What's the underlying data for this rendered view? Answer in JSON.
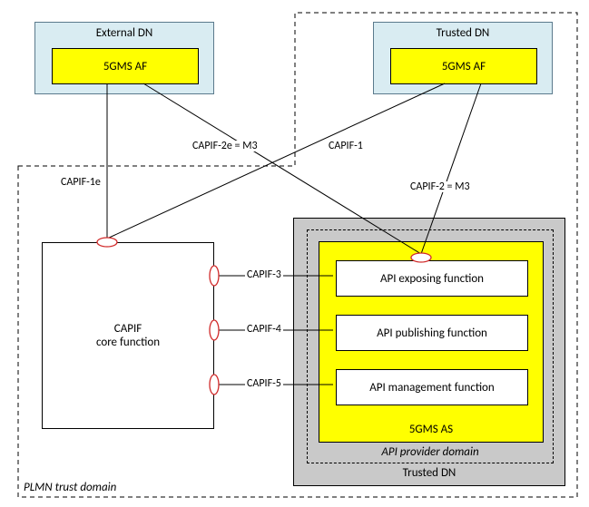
{
  "domains": {
    "plmn": "PLMN trust domain",
    "external_dn": "External DN",
    "trusted_dn_top": "Trusted DN",
    "trusted_dn_bottom": "Trusted DN",
    "api_provider": "API provider domain"
  },
  "nodes": {
    "ext_af": "5GMS AF",
    "trusted_af": "5GMS AF",
    "capif_core_line1": "CAPIF",
    "capif_core_line2": "core function",
    "as": "5GMS AS",
    "api_expose": "API exposing function",
    "api_publish": "API publishing function",
    "api_manage": "API management function"
  },
  "interfaces": {
    "capif_1e": "CAPIF-1e",
    "capif_2e": "CAPIF-2e = M3",
    "capif_1": "CAPIF-1",
    "capif_2": "CAPIF-2 = M3",
    "capif_3": "CAPIF-3",
    "capif_4": "CAPIF-4",
    "capif_5": "CAPIF-5"
  }
}
